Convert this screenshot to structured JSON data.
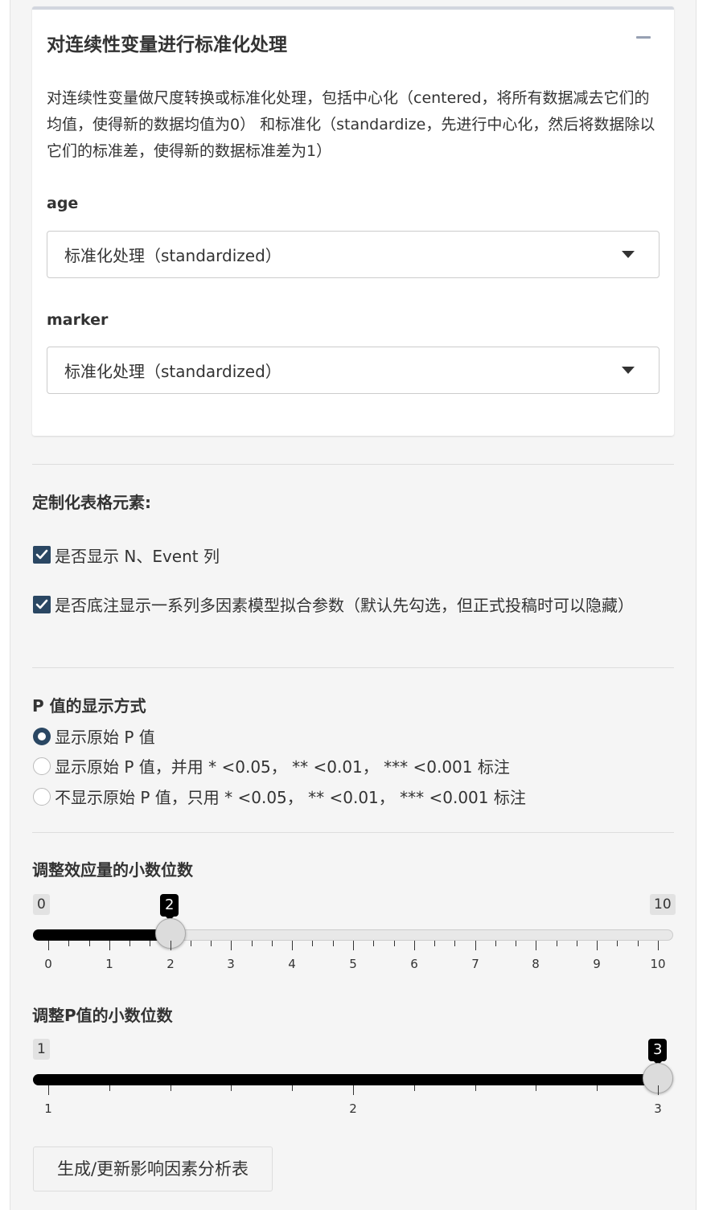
{
  "card": {
    "title": "对连续性变量进行标准化处理",
    "description": "对连续性变量做尺度转换或标准化处理，包括中心化（centered，将所有数据减去它们的均值，使得新的数据均值为0） 和标准化（standardize，先进行中心化，然后将数据除以它们的标准差，使得新的数据标准差为1）",
    "fields": [
      {
        "label": "age",
        "selected": "标准化处理（standardized）"
      },
      {
        "label": "marker",
        "selected": "标准化处理（standardized）"
      }
    ]
  },
  "table_elements": {
    "title": "定制化表格元素:",
    "checkboxes": [
      {
        "label": "是否显示 N、Event 列",
        "checked": true
      },
      {
        "label": "是否底注显示一系列多因素模型拟合参数（默认先勾选，但正式投稿时可以隐藏）",
        "checked": true
      }
    ]
  },
  "p_display": {
    "title": "P 值的显示方式",
    "options": [
      {
        "label": "显示原始 P 值",
        "selected": true
      },
      {
        "label": "显示原始 P 值，并用 * <0.05， ** <0.01， *** <0.001 标注",
        "selected": false
      },
      {
        "label": "不显示原始 P 值，只用 * <0.05， ** <0.01， *** <0.001 标注",
        "selected": false
      }
    ]
  },
  "effect_slider": {
    "title": "调整效应量的小数位数",
    "min_label": "0",
    "max_label": "10",
    "value_label": "2",
    "min": 0,
    "max": 10,
    "value": 2,
    "ticks": [
      "0",
      "1",
      "2",
      "3",
      "4",
      "5",
      "6",
      "7",
      "8",
      "9",
      "10"
    ]
  },
  "p_slider": {
    "title": "调整P值的小数位数",
    "min_label": "1",
    "max_label": "3",
    "value_label": "3",
    "min": 1,
    "max": 3,
    "value": 3,
    "ticks": [
      "1",
      "2",
      "3"
    ]
  },
  "generate_button": {
    "label": "生成/更新影响因素分析表"
  },
  "colors": {
    "accent": "#2a4763",
    "slider_fill": "#000000",
    "panel_bg": "#f5f5f5"
  }
}
